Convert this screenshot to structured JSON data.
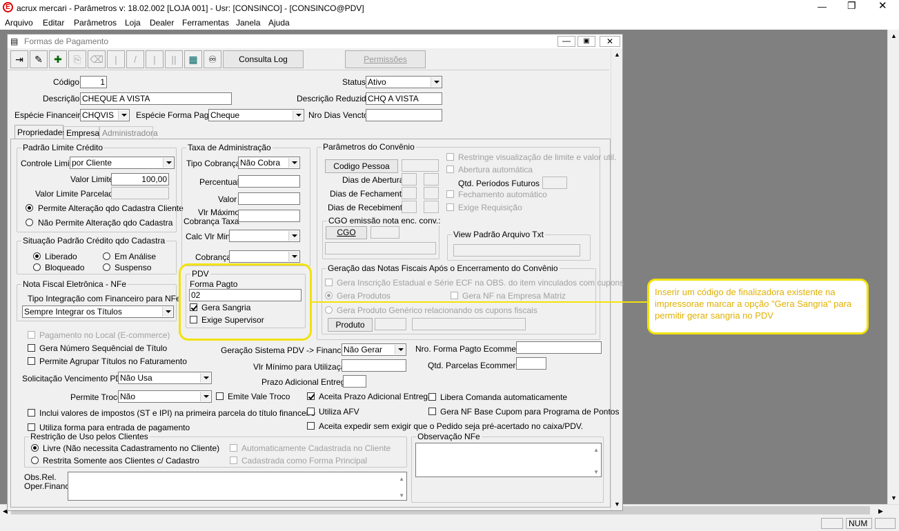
{
  "title": "acrux mercari - Parâmetros  v: 18.02.002  [LOJA 001] - Usr: [CONSINCO] - [CONSINCO@PDV]",
  "menu": [
    "Arquivo",
    "Editar",
    "Parâmetros",
    "Loja",
    "Dealer",
    "Ferramentas",
    "Janela",
    "Ajuda"
  ],
  "child_title": "Formas de Pagamento",
  "toolbar": {
    "consulta_log": "Consulta Log",
    "permissoes": "Permissões"
  },
  "form": {
    "codigo_label": "Código",
    "codigo": "1",
    "status_label": "Status",
    "status": "Ativo",
    "descricao_label": "Descrição",
    "descricao": "CHEQUE A VISTA",
    "desc_reduzida_label": "Descrição Reduzida",
    "desc_reduzida": "CHQ A VISTA",
    "especie_fin_label": "Espécie Financeira",
    "especie_fin": "CHQVIS",
    "especie_forma_label": "Espécie Forma Pagto",
    "especie_forma": "Cheque",
    "nro_dias_label": "Nro Dias Vencto",
    "nro_dias": ""
  },
  "tabs": [
    "Propriedades",
    "Empresas",
    "Administradora"
  ],
  "padrao_limite": {
    "title": "Padrão Limite Crédito",
    "controle_label": "Controle Limite",
    "controle": "por Cliente",
    "valor_limite_label": "Valor Limite",
    "valor_limite": "100,00",
    "valor_parcelado_label": "Valor Limite Parcelado",
    "radio1": "Permite Alteração qdo Cadastra Cliente",
    "radio2": "Não Permite Alteração qdo Cadastra"
  },
  "situacao": {
    "title": "Situação Padrão Crédito qdo Cadastra",
    "liberado": "Liberado",
    "em_analise": "Em Análise",
    "bloqueado": "Bloqueado",
    "suspenso": "Suspenso"
  },
  "nfe": {
    "title": "Nota Fiscal Eletrônica - NFe",
    "tipo_label": "Tipo Integração com Financeiro para NFe",
    "tipo": "Sempre Integrar os Títulos"
  },
  "taxa": {
    "title": "Taxa de Administração",
    "tipo_cobranca_label": "Tipo Cobrança",
    "tipo_cobranca": "Não Cobra",
    "percentual_label": "Percentual",
    "valor_label": "Valor",
    "vlr_max_label1": "Vlr Máximo",
    "vlr_max_label2": "Cobrança Taxa",
    "calc_vlr_label": "Calc Vlr Min",
    "cobranca_label": "Cobrança"
  },
  "pdv": {
    "title": "PDV",
    "forma_pagto_label": "Forma Pagto",
    "forma_pagto": "02",
    "gera_sangria": "Gera Sangria",
    "exige_supervisor": "Exige Supervisor"
  },
  "convenio": {
    "title": "Parâmetros do Convênio",
    "codigo_pessoa": "Codigo Pessoa",
    "dias_abertura": "Dias de Abertura",
    "dias_fechamento": "Dias de Fechamento",
    "dias_recebimento": "Dias de Recebimento",
    "restringe": "Restringe visualização de limite e valor util.",
    "abertura_auto": "Abertura automática",
    "qtd_periodos": "Qtd. Períodos Futuros",
    "fechamento_auto": "Fechamento automático",
    "exige_requisicao": "Exige Requisição",
    "cgo_title": "CGO emissão nota enc. conv.:",
    "cgo_btn": "CGO",
    "view_padrao": "View Padrão Arquivo Txt"
  },
  "geracao": {
    "title": "Geração das Notas Fiscais Após o Encerramento do Convênio",
    "gera_inscricao": "Gera Inscrição Estadual e Série ECF na OBS. do item vinculados com cupons",
    "gera_produtos": "Gera Produtos",
    "gera_nf_matriz": "Gera NF na Empresa Matriz",
    "gera_generico": "Gera Produto Genérico relacionando os cupons fiscais",
    "produto_btn": "Produto"
  },
  "annotation": "Inserir um código de finalizadora existente na impressorae marcar a opção \"Gera Sangria\" para permitir gerar sangria no PDV",
  "lower": {
    "pagamento_local": "Pagamento no Local (E-commerce)",
    "gera_numero": "Gera Número Sequêncial de Título",
    "permite_agrupar": "Permite Agrupar Títulos no Faturamento",
    "solicitacao_label": "Solicitação Vencimento PDV",
    "solicitacao": "Não Usa",
    "permite_troco_label": "Permite Troco",
    "permite_troco": "Não",
    "emite_vale": "Emite Vale Troco",
    "inclui_valores": "Inclui valores de impostos (ST e IPI) na primeira parcela do título financeiro",
    "utiliza_forma": "Utiliza forma para entrada de pagamento",
    "geracao_sistema_label": "Geração Sistema PDV -> Financeiro",
    "geracao_sistema": "Não Gerar",
    "vlr_minimo_label": "Vlr Mínimo para Utilização",
    "prazo_adicional_label": "Prazo Adicional Entrega",
    "nro_forma_ecom_label": "Nro. Forma Pagto Ecommerce",
    "qtd_parcelas_label": "Qtd. Parcelas Ecommerce",
    "aceita_prazo": "Aceita Prazo Adicional Entrega",
    "libera_comanda": "Libera Comanda automaticamente",
    "utiliza_afv": "Utiliza AFV",
    "gera_nf_base": "Gera NF Base Cupom para Programa de Pontos",
    "aceita_expedir": "Aceita expedir sem exigir que o Pedido seja pré-acertado no caixa/PDV.",
    "restricao_title": "Restrição de Uso pelos Clientes",
    "livre": "Livre (Não necessita Cadastramento no Cliente)",
    "restrita": "Restrita Somente aos Clientes c/ Cadastro",
    "auto_cadastrada": "Automaticamente Cadastrada no Cliente",
    "cadastrada_principal": "Cadastrada como Forma Principal",
    "obs_nfe_title": "Observação NFe",
    "obs_rel_label1": "Obs.Rel.",
    "obs_rel_label2": "Oper.Financ."
  },
  "status_bar": {
    "num": "NUM"
  }
}
